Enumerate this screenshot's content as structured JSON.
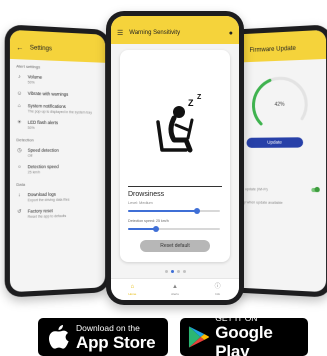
{
  "left_phone": {
    "bar_title": "Settings",
    "sections": [
      {
        "header": "Alert settings",
        "rows": [
          {
            "icon": "volume-icon",
            "title": "Volume",
            "sub": "50%"
          },
          {
            "icon": "person-icon",
            "title": "Vibrate with warnings",
            "sub": ""
          },
          {
            "icon": "bell-icon",
            "title": "System notifications",
            "sub": "The pop-up is displayed in the system tray"
          },
          {
            "icon": "bulb-icon",
            "title": "LED flash alerts",
            "sub": "50%"
          }
        ]
      },
      {
        "header": "Detection",
        "rows": [
          {
            "icon": "speed-icon",
            "title": "Speed detection",
            "sub": "Off"
          },
          {
            "icon": "speed-limit-icon",
            "title": "Detection speed",
            "sub": "25 km/h"
          }
        ]
      },
      {
        "header": "Data",
        "rows": [
          {
            "icon": "download-icon",
            "title": "Download logs",
            "sub": "Export the driving data files"
          },
          {
            "icon": "reset-icon",
            "title": "Factory reset",
            "sub": "Reset the app to defaults"
          }
        ]
      }
    ]
  },
  "center_phone": {
    "bar_title": "Warning Sensitivity",
    "card_title": "Drowsiness",
    "card_sub": "Level: Medium",
    "slider_label": "Detection speed: 25 km/h",
    "slider_values": [
      0.75,
      0.3
    ],
    "reset_label": "Reset default",
    "pager_count": 4,
    "pager_active": 1,
    "nav": [
      {
        "icon": "home-icon",
        "label": "Home",
        "active": true
      },
      {
        "icon": "warning-icon",
        "label": "Alerts",
        "active": false
      },
      {
        "icon": "info-icon",
        "label": "Info",
        "active": false
      }
    ]
  },
  "right_phone": {
    "bar_title": "Firmware Update",
    "gauge_value": 0.42,
    "gauge_label": "42%",
    "update_label": "Update",
    "rows": [
      {
        "text": "Auto update (Wi-Fi)",
        "toggle": true
      },
      {
        "text": "Notify when update available",
        "toggle": false
      }
    ]
  },
  "badges": {
    "apple_small": "Download on the",
    "apple_big": "App Store",
    "google_small": "GET IT ON",
    "google_big": "Google Play"
  },
  "colors": {
    "appbar": "#f5d33b",
    "accent": "#3f6fd6",
    "update_button": "#2740a8",
    "gauge": "#3fb34f"
  }
}
